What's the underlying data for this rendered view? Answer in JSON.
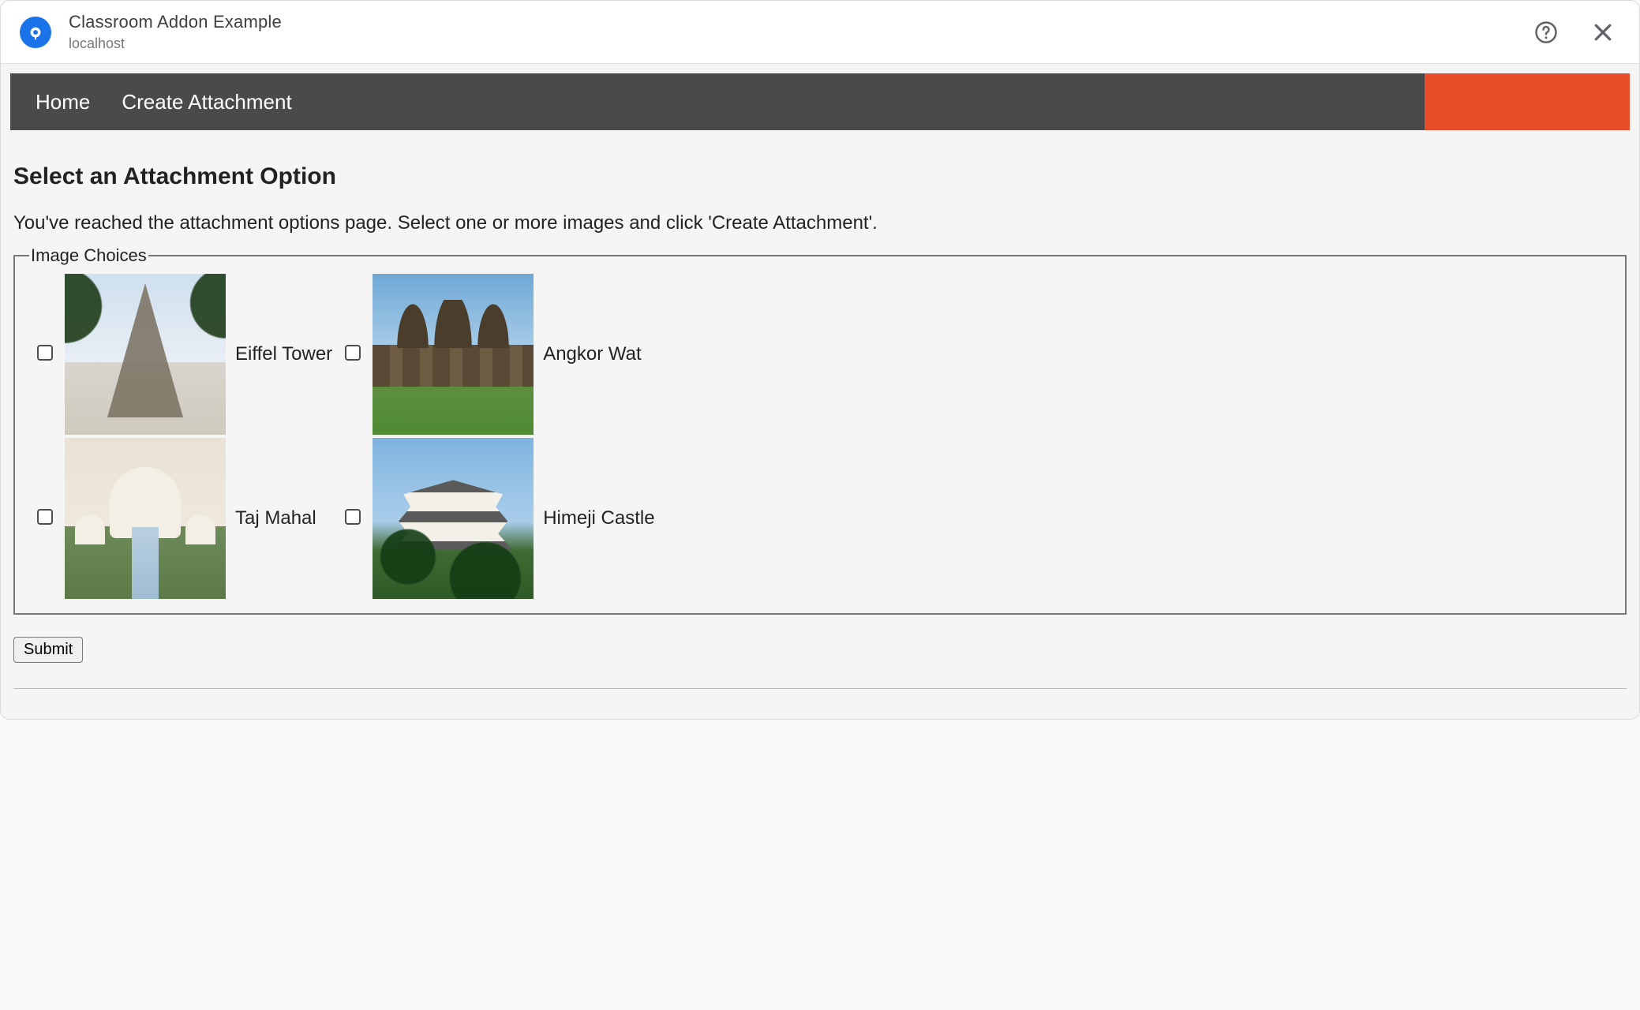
{
  "dialog": {
    "title": "Classroom Addon Example",
    "subtitle": "localhost"
  },
  "nav": {
    "items": [
      {
        "label": "Home"
      },
      {
        "label": "Create Attachment"
      }
    ]
  },
  "page": {
    "heading": "Select an Attachment Option",
    "description": "You've reached the attachment options page. Select one or more images and click 'Create Attachment'.",
    "fieldset_legend": "Image Choices",
    "submit_label": "Submit"
  },
  "options": [
    {
      "label": "Eiffel Tower",
      "checked": false,
      "thumb_key": "eiffel"
    },
    {
      "label": "Angkor Wat",
      "checked": false,
      "thumb_key": "angkor"
    },
    {
      "label": "Taj Mahal",
      "checked": false,
      "thumb_key": "taj"
    },
    {
      "label": "Himeji Castle",
      "checked": false,
      "thumb_key": "himeji"
    }
  ]
}
